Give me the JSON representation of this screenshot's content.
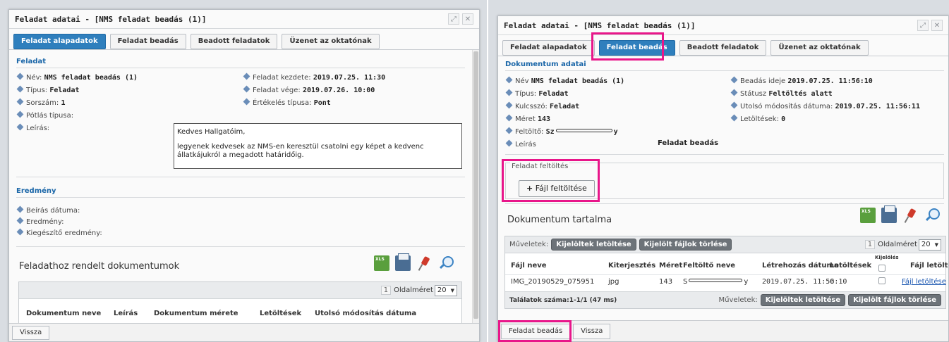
{
  "left": {
    "title": "Feladat adatai - [NMS feladat beadás (1)]",
    "tabs": [
      "Feladat alapadatok",
      "Feladat beadás",
      "Beadott feladatok",
      "Üzenet az oktatónak"
    ],
    "section_feladat": "Feladat",
    "fields_left": [
      {
        "label": "Név:",
        "value": "NMS feladat beadás (1)"
      },
      {
        "label": "Típus:",
        "value": "Feladat"
      },
      {
        "label": "Sorszám:",
        "value": "1"
      },
      {
        "label": "Pótlás típusa:",
        "value": ""
      },
      {
        "label": "Leírás:",
        "value": ""
      }
    ],
    "fields_right": [
      {
        "label": "Feladat kezdete:",
        "value": "2019.07.25. 11:30"
      },
      {
        "label": "Feladat vége:",
        "value": "2019.07.26. 10:00"
      },
      {
        "label": "Értékelés típusa:",
        "value": "Pont"
      }
    ],
    "description_line1": "Kedves Hallgatóim,",
    "description_line2": "legyenek kedvesek az NMS-en keresztül csatolni egy képet a kedvenc",
    "description_line3": "állatkájukról a megadott határidőig.",
    "section_eredmeny": "Eredmény",
    "result_fields": [
      "Beírás dátuma:",
      "Eredmény:",
      "Kiegészítő eredmény:"
    ],
    "docs_title": "Feladathoz rendelt dokumentumok",
    "page_num": "1",
    "page_size_label": "Oldalméret",
    "page_size_value": "20",
    "columns": [
      "Dokumentum neve",
      "Leírás",
      "Dokumentum mérete",
      "Letöltések",
      "Utolsó módosítás dátuma"
    ],
    "bottom_buttons": [
      "Vissza"
    ]
  },
  "right": {
    "title": "Feladat adatai - [NMS feladat beadás (1)]",
    "tabs": [
      "Feladat alapadatok",
      "Feladat beadás",
      "Beadott feladatok",
      "Üzenet az oktatónak"
    ],
    "section_doc": "Dokumentum adatai",
    "fields_left": [
      {
        "label": "Név",
        "value": "NMS feladat beadás (1)"
      },
      {
        "label": "Típus:",
        "value": "Feladat"
      },
      {
        "label": "Kulcsszó:",
        "value": "Feladat"
      },
      {
        "label": "Méret",
        "value": "143"
      },
      {
        "label": "Feltöltő:",
        "value_prefix": "Sz",
        "value_suffix": "y"
      },
      {
        "label": "Leírás",
        "value": "Feladat beadás"
      }
    ],
    "fields_right": [
      {
        "label": "Beadás ideje",
        "value": "2019.07.25. 11:56:10"
      },
      {
        "label": "Státusz",
        "value": "Feltöltés alatt"
      },
      {
        "label": "Utolsó módosítás dátuma:",
        "value": "2019.07.25. 11:56:11"
      },
      {
        "label": "Letöltések:",
        "value": "0"
      }
    ],
    "upload_legend": "Feladat feltöltés",
    "upload_button": "Fájl feltöltése",
    "upload_plus": "+",
    "content_title": "Dokumentum tartalma",
    "actions_label": "Műveletek:",
    "btn_download": "Kijelöltek letöltése",
    "btn_delete": "Kijelölt fájlok törlése",
    "page_num": "1",
    "page_size_label": "Oldalméret",
    "page_size_value": "20",
    "columns": [
      "Fájl neve",
      "Kiterjesztés",
      "Méret",
      "Feltöltő neve",
      "Létrehozás dátuma",
      "Letöltések",
      "Kijelölés",
      "Fájl letöltése"
    ],
    "row": {
      "file": "IMG_20190529_075951",
      "ext": "jpg",
      "size": "143",
      "uploader_prefix": "S",
      "uploader_suffix": "y",
      "created": "2019.07.25. 11:56:10",
      "downloads": "0",
      "download_link": "Fájl letöltése"
    },
    "footer_count": "Találatok száma:1-1/1 (47 ms)",
    "bottom_buttons": [
      "Feladat beadás",
      "Vissza"
    ]
  },
  "colors": {
    "active_tab": "#2f7fbd",
    "section_title": "#1a66a8",
    "highlight": "#e8168a",
    "dark_button": "#6d7379"
  },
  "icons": [
    "maximize-icon",
    "close-icon",
    "xls-export-icon",
    "print-icon",
    "pin-icon",
    "search-icon",
    "plus-icon",
    "chevron-down-icon"
  ]
}
